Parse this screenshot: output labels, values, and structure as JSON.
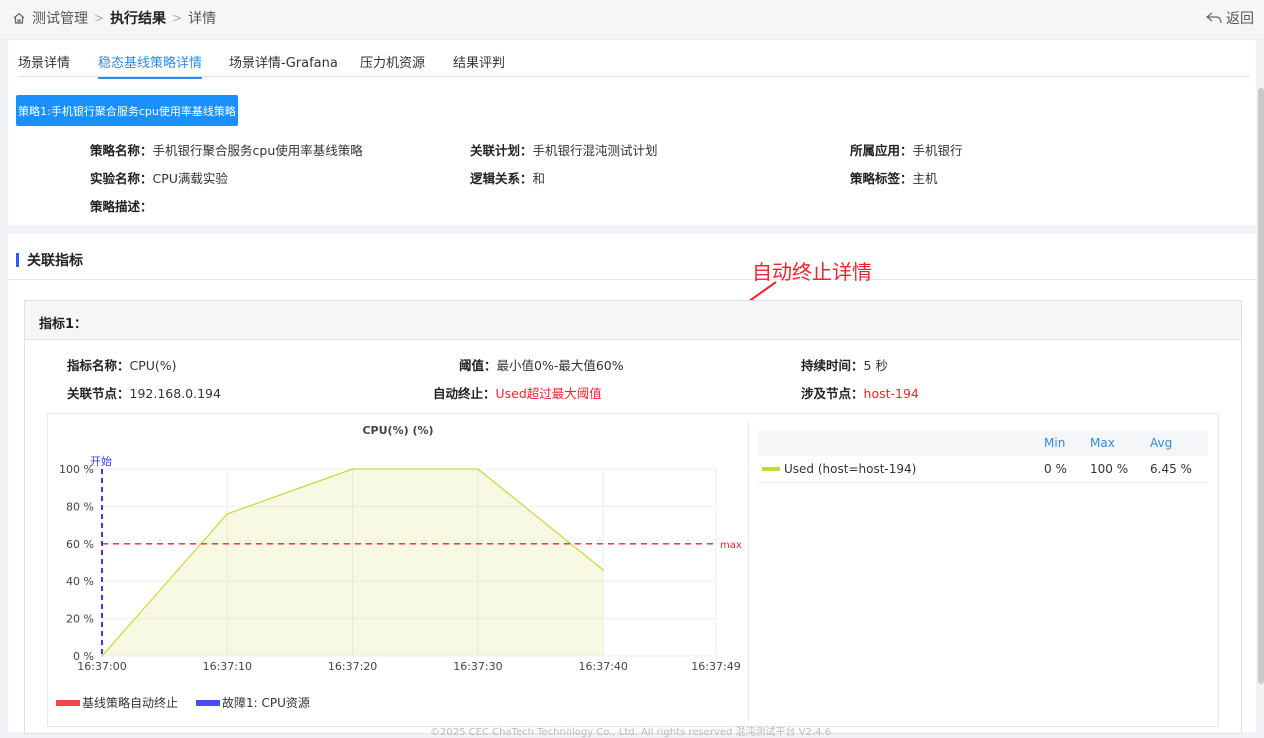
{
  "breadcrumb": {
    "home": "测试管理",
    "current": "执行结果",
    "detail": "详情"
  },
  "back_label": "返回",
  "tabs": [
    "场景详情",
    "稳态基线策略详情",
    "场景详情-Grafana",
    "压力机资源",
    "结果评判"
  ],
  "active_tab": 1,
  "strategy_button": "策略1:手机银行聚合服务cpu使用率基线策略",
  "strategy": {
    "name_k": "策略名称：",
    "name_v": "手机银行聚合服务cpu使用率基线策略",
    "plan_k": "关联计划：",
    "plan_v": "手机银行混沌测试计划",
    "app_k": "所属应用：",
    "app_v": "手机银行",
    "exp_k": "实验名称：",
    "exp_v": "CPU满载实验",
    "logic_k": "逻辑关系：",
    "logic_v": "和",
    "tag_k": "策略标签：",
    "tag_v": "主机",
    "desc_k": "策略描述：",
    "desc_v": ""
  },
  "section_title": "关联指标",
  "annotation": "自动终止详情",
  "metric": {
    "title": "指标1：",
    "name_k": "指标名称：",
    "name_v": "CPU(%)",
    "threshold_k": "阈值：",
    "threshold_v": "最小值0%-最大值60%",
    "duration_k": "持续时间：",
    "duration_v": "5 秒",
    "node_k": "关联节点：",
    "node_v": "192.168.0.194",
    "autostop_k": "自动终止：",
    "autostop_v": "Used超过最大阈值",
    "involved_k": "涉及节点：",
    "involved_v": "host-194"
  },
  "chart_data": {
    "type": "area",
    "title": "CPU(%) (%)",
    "x": [
      "16:37:00",
      "16:37:10",
      "16:37:20",
      "16:37:30",
      "16:37:40"
    ],
    "x_ticks": [
      "16:37:00",
      "16:37:10",
      "16:37:20",
      "16:37:30",
      "16:37:40",
      "16:37:49"
    ],
    "y_ticks": [
      "0 %",
      "20 %",
      "40 %",
      "60 %",
      "80 %",
      "100 %"
    ],
    "ylim": [
      0,
      100
    ],
    "series": [
      {
        "name": "Used (host=host-194)",
        "values": [
          0,
          76,
          100,
          100,
          46
        ],
        "color": "#c7d93a"
      }
    ],
    "threshold": {
      "label": "max",
      "value": 60,
      "color": "#f5222d"
    },
    "start_marker": {
      "label": "开始",
      "x": "16:37:00",
      "color": "#3b3bf5"
    },
    "table_headers": [
      "Min",
      "Max",
      "Avg"
    ],
    "table_rows": [
      {
        "name": "Used (host=host-194)",
        "min": "0 %",
        "max": "100 %",
        "avg": "6.45 %"
      }
    ],
    "bottom_legend": [
      {
        "label": "基线策略自动终止",
        "color": "#f5444b"
      },
      {
        "label": "故障1: CPU资源",
        "color": "#4b4bf5"
      }
    ]
  },
  "footer": "©2025 CEC ChaTech Technology Co., Ltd. All rights reserved 混沌测试平台 V2.4.6"
}
